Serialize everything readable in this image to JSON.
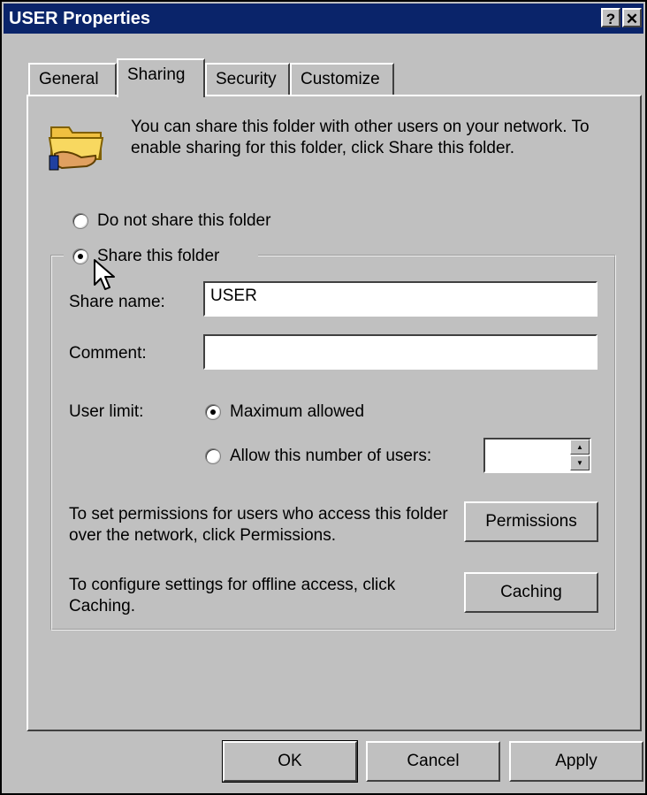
{
  "window": {
    "title": "USER Properties",
    "help_label": "?",
    "close_label": "✕"
  },
  "tabs": [
    {
      "label": "General"
    },
    {
      "label": "Sharing",
      "active": true
    },
    {
      "label": "Security"
    },
    {
      "label": "Customize"
    }
  ],
  "intro_text": "You can share this folder with other users on your network.  To enable sharing for this folder, click Share this folder.",
  "sharing": {
    "do_not_share_label": "Do not share this folder",
    "share_label": "Share this folder",
    "share_selected": true,
    "share_name_label": "Share name:",
    "share_name_value": "USER",
    "comment_label": "Comment:",
    "comment_value": "",
    "user_limit_label": "User limit:",
    "max_allowed_label": "Maximum allowed",
    "allow_number_label": "Allow this number of users:",
    "allow_number_value": "",
    "permissions_text": "To set permissions for users who access this folder over the network, click Permissions.",
    "permissions_button": "Permissions",
    "caching_text": "To configure settings for offline access, click Caching.",
    "caching_button": "Caching"
  },
  "footer": {
    "ok": "OK",
    "cancel": "Cancel",
    "apply": "Apply"
  },
  "icons": {
    "folder": "shared-folder-icon",
    "cursor": "mouse-pointer-icon"
  }
}
